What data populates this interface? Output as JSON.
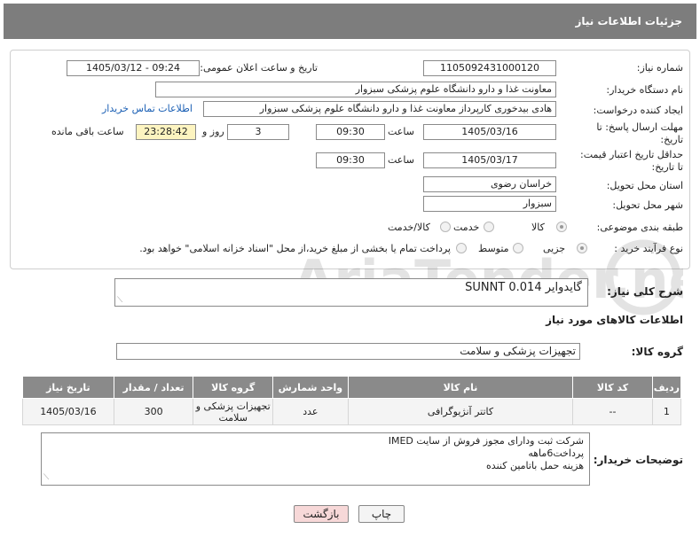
{
  "header": {
    "title": "جزئیات اطلاعات نیاز"
  },
  "form": {
    "need_number_label": "شماره نیاز:",
    "need_number": "1105092431000120",
    "announce_label": "تاریخ و ساعت اعلان عمومی:",
    "announce_value": "1405/03/12 - 09:24",
    "buyer_org_label": "نام دستگاه خریدار:",
    "buyer_org": "معاونت غذا و دارو   دانشگاه علوم پزشکی سبزوار",
    "requester_label": "ایجاد کننده درخواست:",
    "requester": "هادی بیدخوری کارپرداز معاونت غذا و دارو   دانشگاه علوم پزشکی سبزوار",
    "contact_link": "اطلاعات تماس خریدار",
    "deadline_label_1": "مهلت ارسال پاسخ: تا",
    "deadline_label_2": "تاریخ:",
    "deadline_date": "1405/03/16",
    "time_label": "ساعت",
    "deadline_time": "09:30",
    "days_value": "3",
    "days_label": "روز و",
    "remaining_time": "23:28:42",
    "remaining_label": "ساعت باقی مانده",
    "validity_label_1": "حداقل تاریخ اعتبار قیمت:",
    "validity_label_2": "تا تاریخ:",
    "validity_date": "1405/03/17",
    "validity_time": "09:30",
    "province_label": "استان محل تحویل:",
    "province": "خراسان رضوی",
    "city_label": "شهر محل تحویل:",
    "city": "سبزوار",
    "category_label": "طبقه بندی موضوعی:",
    "category_options": [
      "کالا",
      "خدمت",
      "کالا/خدمت"
    ],
    "process_label": "نوع فرآیند خرید :",
    "process_options": [
      "جزیی",
      "متوسط"
    ],
    "process_note": "پرداخت تمام یا بخشی از مبلغ خرید،از محل \"اسناد خزانه اسلامی\" خواهد بود."
  },
  "summary": {
    "label": "شرح کلی نیاز:",
    "value": "گایدوایر SUNNT 0.014"
  },
  "goods_section": {
    "title": "اطلاعات کالاهای مورد نیاز",
    "group_label": "گروه کالا:",
    "group_value": "تجهیزات پزشکی و سلامت"
  },
  "table": {
    "headers": [
      "ردیف",
      "کد کالا",
      "نام کالا",
      "واحد شمارش",
      "گروه کالا",
      "تعداد / مقدار",
      "تاریخ نیاز"
    ],
    "rows": [
      {
        "row": "1",
        "code": "--",
        "name": "کاتتر آنژیوگرافی",
        "unit": "عدد",
        "group": "تجهیزات پزشکی و سلامت",
        "qty": "300",
        "date": "1405/03/16"
      }
    ]
  },
  "buyer_notes": {
    "label": "توضیحات خریدار:",
    "lines": [
      "شرکت ثبت ودارای مجوز فروش از سایت IMED",
      "پرداخت6ماهه",
      "هزینه حمل باتامین کننده"
    ]
  },
  "buttons": {
    "print": "چاپ",
    "back": "بازگشت"
  },
  "watermark": {
    "text": "AriaTender.net"
  },
  "colors": {
    "header_bg": "#7d7d7d",
    "table_header_bg": "#8a8a8a",
    "highlight_yellow": "#fdf4c0",
    "link": "#1a5fb4",
    "back_button_bg": "#f7d8d8"
  }
}
